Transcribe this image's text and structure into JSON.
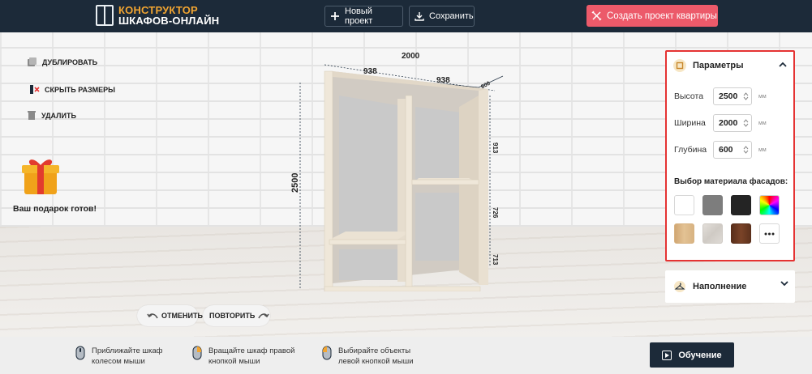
{
  "header": {
    "logo_line1": "КОНСТРУКТОР",
    "logo_line2": "ШКАФОВ-ОНЛАЙН",
    "new_project_label": "Новый проект",
    "save_label": "Сохранить",
    "apartment_label": "Создать проект квартиры"
  },
  "tools": {
    "duplicate_label": "ДУБЛИРОВАТЬ",
    "hide_sizes_label": "СКРЫТЬ РАЗМЕРЫ",
    "delete_label": "УДАЛИТЬ"
  },
  "gift": {
    "text": "Ваш подарок готов!"
  },
  "history": {
    "undo_label": "ОТМЕНИТЬ",
    "redo_label": "ПОВТОРИТЬ"
  },
  "dimensions": {
    "total_width": "2000",
    "left_section": "938",
    "right_section": "938",
    "depth": "600",
    "height": "2500",
    "shelf_top": "913",
    "shelf_mid": "726",
    "shelf_bottom": "713"
  },
  "params": {
    "title": "Параметры",
    "height_label": "Высота",
    "height_value": "2500",
    "width_label": "Ширина",
    "width_value": "2000",
    "depth_label": "Глубина",
    "depth_value": "600",
    "unit": "мм",
    "material_title": "Выбор материала фасадов:",
    "swatches": [
      {
        "name": "white",
        "color": "#ffffff"
      },
      {
        "name": "gray",
        "color": "#7d7d7d"
      },
      {
        "name": "black",
        "color": "#242424"
      },
      {
        "name": "custom-color",
        "color": "rainbow"
      },
      {
        "name": "oak-light",
        "color": "#d8b382"
      },
      {
        "name": "concrete",
        "color": "#d9d5d0"
      },
      {
        "name": "walnut",
        "color": "#6b3a22"
      },
      {
        "name": "more",
        "color": "#ffffff"
      }
    ]
  },
  "filling": {
    "title": "Наполнение"
  },
  "hints": {
    "zoom_line1": "Приближайте шкаф",
    "zoom_line2": "колесом мыши",
    "rotate_line1": "Вращайте шкаф правой",
    "rotate_line2": "кнопкой мыши",
    "select_line1": "Выбирайте объекты",
    "select_line2": "левой кнопкой мыши"
  },
  "tutorial_label": "Обучение"
}
